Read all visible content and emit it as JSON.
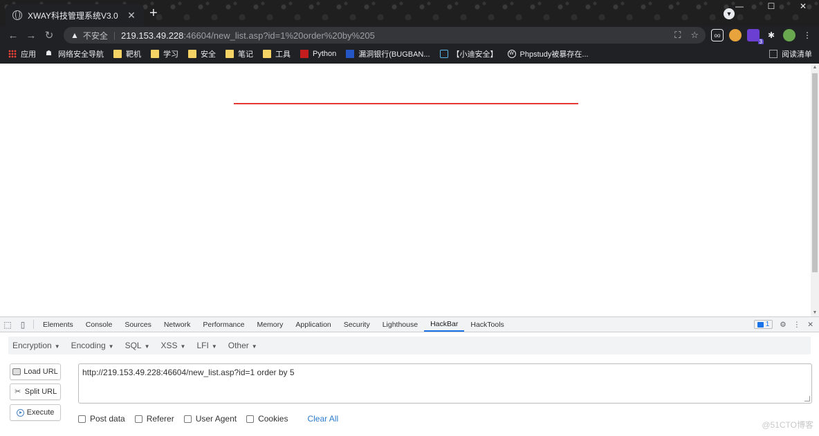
{
  "browser": {
    "tab_title": "XWAY科技管理系统V3.0",
    "tab_close": "✕",
    "new_tab": "+",
    "window_controls": [
      "—",
      "☐",
      "✕"
    ],
    "nav": {
      "back": "←",
      "forward": "→",
      "reload": "↻"
    },
    "omnibox": {
      "warning_icon": "▲",
      "insecure_label": "不安全",
      "separator": "|",
      "host": "219.153.49.228",
      "path": ":46604/new_list.asp?id=1%20order%20by%205",
      "translate_icon": "⛶",
      "star_icon": "☆"
    },
    "extensions": [
      "oo",
      "",
      "3",
      "✱",
      ""
    ],
    "extension_badge": "3",
    "menu": "⋮",
    "bookmarks": [
      {
        "label": "应用",
        "icon": "apps-grid-icon"
      },
      {
        "label": "网络安全导航",
        "icon": "site-icon"
      },
      {
        "label": "靶机",
        "icon": "folder-icon"
      },
      {
        "label": "学习",
        "icon": "folder-icon"
      },
      {
        "label": "安全",
        "icon": "folder-icon"
      },
      {
        "label": "笔记",
        "icon": "folder-icon"
      },
      {
        "label": "工具",
        "icon": "folder-icon"
      },
      {
        "label": "Python",
        "icon": "python-icon"
      },
      {
        "label": "漏洞银行(BUGBAN...",
        "icon": "bugbank-icon"
      },
      {
        "label": "【小迪安全】",
        "icon": "tv-icon"
      },
      {
        "label": "Phpstudy被暴存在...",
        "icon": "wordpress-icon"
      }
    ],
    "reading_list": "阅读清单"
  },
  "devtools": {
    "tabs": [
      "Elements",
      "Console",
      "Sources",
      "Network",
      "Performance",
      "Memory",
      "Application",
      "Security",
      "Lighthouse",
      "HackBar",
      "HackTools"
    ],
    "active_tab": "HackBar",
    "issues_count": "1",
    "settings_icon": "⚙",
    "more_icon": "⋮",
    "close_icon": "✕"
  },
  "hackbar": {
    "menu": [
      "Encryption",
      "Encoding",
      "SQL",
      "XSS",
      "LFI",
      "Other"
    ],
    "load_url": "Load URL",
    "split_url": "Split URL",
    "execute": "Execute",
    "url_value": "http://219.153.49.228:46604/new_list.asp?id=1 order by 5",
    "options": [
      "Post data",
      "Referer",
      "User Agent",
      "Cookies"
    ],
    "clear_all": "Clear All"
  },
  "watermark": "@51CTO博客",
  "colors": {
    "accent": "#1a73e8",
    "red_line": "#e53935",
    "chrome_dark": "#202124"
  }
}
